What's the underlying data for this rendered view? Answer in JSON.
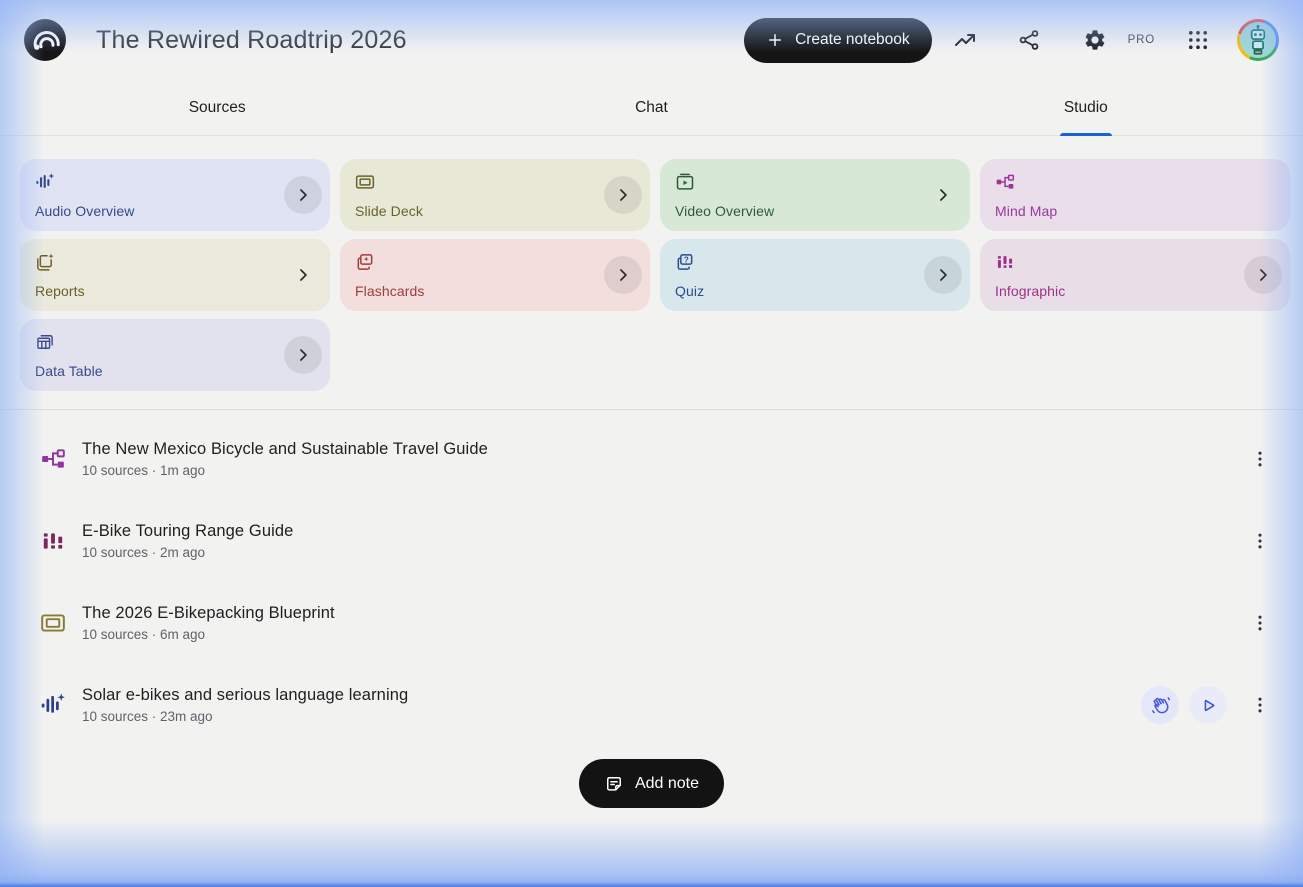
{
  "header": {
    "title": "The Rewired Roadtrip 2026",
    "create_button_label": "Create notebook",
    "pro_label": "PRO"
  },
  "tabs": [
    {
      "label": "Sources",
      "active": false
    },
    {
      "label": "Chat",
      "active": false
    },
    {
      "label": "Studio",
      "active": true
    }
  ],
  "studio_cards": [
    {
      "slug": "audio-overview",
      "label": "Audio Overview",
      "icon": "i-audio",
      "bg": "#dfe3f3",
      "fg": "#35488c",
      "chevron": "circle"
    },
    {
      "slug": "slide-deck",
      "label": "Slide Deck",
      "icon": "i-slide",
      "bg": "#e8e8d7",
      "fg": "#67642a",
      "chevron": "circle"
    },
    {
      "slug": "video-overview",
      "label": "Video Overview",
      "icon": "i-video",
      "bg": "#d7e8d6",
      "fg": "#2d5b38",
      "chevron": "bare"
    },
    {
      "slug": "mind-map",
      "label": "Mind Map",
      "icon": "i-mindmap",
      "bg": "#e9dee9",
      "fg": "#97399b",
      "chevron": "none"
    },
    {
      "slug": "reports",
      "label": "Reports",
      "icon": "i-reports",
      "bg": "#eae9db",
      "fg": "#6a5d24",
      "chevron": "bare"
    },
    {
      "slug": "flashcards",
      "label": "Flashcards",
      "icon": "i-flashcards",
      "bg": "#f1dedd",
      "fg": "#a03d3a",
      "chevron": "circle"
    },
    {
      "slug": "quiz",
      "label": "Quiz",
      "icon": "i-quiz",
      "bg": "#d8e7ec",
      "fg": "#27508d",
      "chevron": "circle"
    },
    {
      "slug": "infographic",
      "label": "Infographic",
      "icon": "i-infographic",
      "bg": "#e9dde7",
      "fg": "#9e2f8d",
      "chevron": "circle"
    },
    {
      "slug": "data-table",
      "label": "Data Table",
      "icon": "i-datatable",
      "bg": "#e1e2ed",
      "fg": "#39498c",
      "chevron": "circle"
    }
  ],
  "artifacts": [
    {
      "title": "The New Mexico Bicycle and Sustainable Travel Guide",
      "meta": "10 sources · 1m ago",
      "icon": "i-mindmap",
      "icon_name": "mind-map-icon",
      "icon_color": "#8e35a0",
      "actions": []
    },
    {
      "title": "E-Bike Touring Range Guide",
      "meta": "10 sources · 2m ago",
      "icon": "i-infographic",
      "icon_name": "infographic-icon",
      "icon_color": "#7b2a60",
      "actions": []
    },
    {
      "title": "The 2026 E-Bikepacking Blueprint",
      "meta": "10 sources · 6m ago",
      "icon": "i-slide",
      "icon_name": "slide-deck-icon",
      "icon_color": "#877c33",
      "actions": []
    },
    {
      "title": "Solar e-bikes and serious language learning",
      "meta": "10 sources · 23m ago",
      "icon": "i-audio",
      "icon_name": "audio-overview-icon",
      "icon_color": "#2c3e8a",
      "actions": [
        "interactive",
        "play"
      ]
    }
  ],
  "footer": {
    "add_note_label": "Add note"
  },
  "colors": {
    "tab_underline": "#1b63d4",
    "edge_glow": "#8fb1f5",
    "pill_button": "#151515"
  }
}
